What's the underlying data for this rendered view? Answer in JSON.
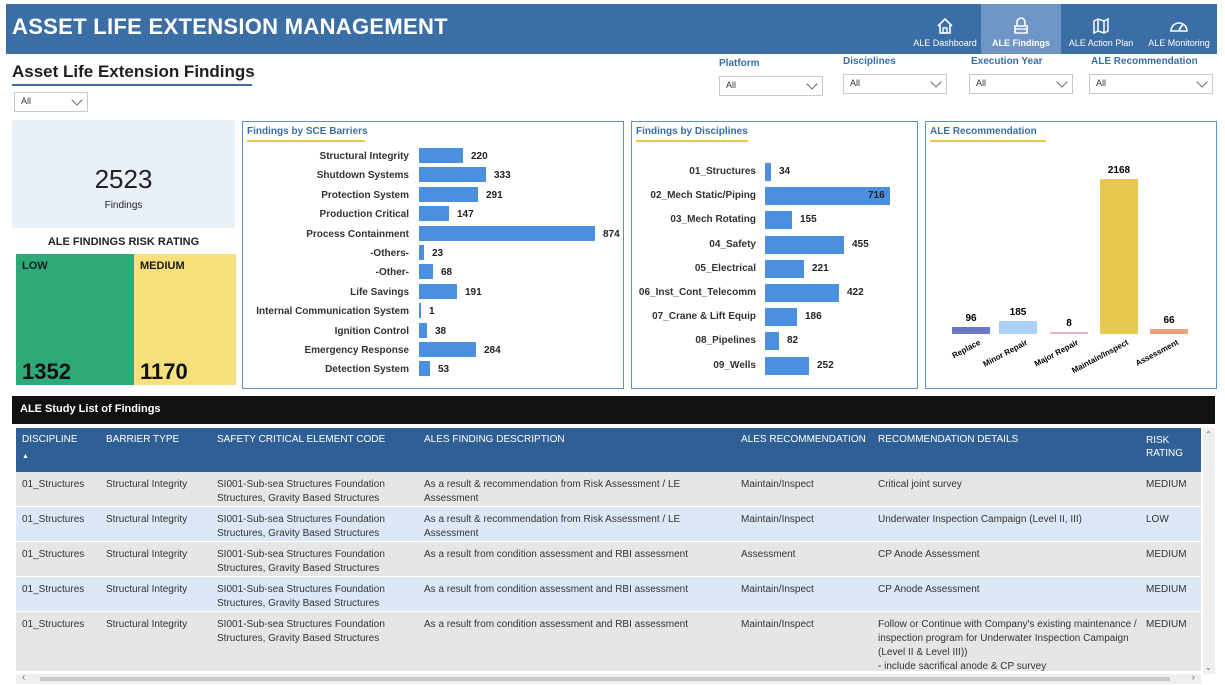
{
  "header": {
    "title": "ASSET LIFE EXTENSION MANAGEMENT",
    "nav": [
      {
        "label": "ALE Dashboard",
        "icon": "home-icon",
        "active": false
      },
      {
        "label": "ALE Findings",
        "icon": "findings-icon",
        "active": true
      },
      {
        "label": "ALE Action Plan",
        "icon": "map-icon",
        "active": false
      },
      {
        "label": "ALE Monitoring",
        "icon": "gauge-icon",
        "active": false
      }
    ]
  },
  "page": {
    "title": "Asset Life Extension Findings",
    "left_filter_value": "All"
  },
  "filters": [
    {
      "label": "Platform",
      "value": "All"
    },
    {
      "label": "Disciplines",
      "value": "All"
    },
    {
      "label": "Execution Year",
      "value": "All"
    },
    {
      "label": "ALE Recommendation",
      "value": "All"
    }
  ],
  "kpi": {
    "value": "2523",
    "label": "Findings"
  },
  "risk": {
    "title": "ALE FINDINGS RISK RATING",
    "low_label": "LOW",
    "low_value": "1352",
    "medium_label": "MEDIUM",
    "medium_value": "1170",
    "colors": {
      "low": "#2eaa79",
      "medium": "#f5e07b"
    }
  },
  "charts": {
    "sce": {
      "title": "Findings by SCE Barriers",
      "chart_data": {
        "type": "bar",
        "orientation": "horizontal",
        "categories": [
          "Structural Integrity",
          "Shutdown Systems",
          "Protection System",
          "Production Critical",
          "Process Containment",
          "-Others-",
          "-Other-",
          "Life Savings",
          "Internal Communication System",
          "Ignition Control",
          "Emergency Response",
          "Detection System"
        ],
        "values": [
          220,
          333,
          291,
          147,
          874,
          23,
          68,
          191,
          1,
          38,
          284,
          53
        ]
      }
    },
    "disc": {
      "title": "Findings by Disciplines",
      "chart_data": {
        "type": "bar",
        "orientation": "horizontal",
        "categories": [
          "01_Structures",
          "02_Mech Static/Piping",
          "03_Mech Rotating",
          "04_Safety",
          "05_Electrical",
          "06_Inst_Cont_Telecomm",
          "07_Crane & Lift Equip",
          "08_Pipelines",
          "09_Wells"
        ],
        "values": [
          34,
          716,
          155,
          455,
          221,
          422,
          186,
          82,
          252
        ]
      }
    },
    "rec": {
      "title": "ALE Recommendation",
      "chart_data": {
        "type": "bar",
        "orientation": "vertical",
        "categories": [
          "Replace",
          "Minor Repair",
          "Major Repair",
          "Maintain/Inspect",
          "Assessment"
        ],
        "values": [
          96,
          185,
          8,
          2168,
          66
        ],
        "colors": [
          "#6b78c8",
          "#a9d2f5",
          "#e8b0c4",
          "#e8c94f",
          "#ee9f7c"
        ]
      }
    },
    "bar_color": "#4a8fe0"
  },
  "table": {
    "title": "ALE Study List of Findings",
    "columns": [
      "DISCIPLINE",
      "BARRIER TYPE",
      "SAFETY CRITICAL ELEMENT CODE",
      "ALES FINDING DESCRIPTION",
      "ALES RECOMMENDATION",
      "RECOMMENDATION DETAILS",
      "RISK RATING"
    ],
    "rows": [
      [
        "01_Structures",
        "Structural Integrity",
        "SI001-Sub-sea Structures Foundation Structures, Gravity Based Structures",
        "As a result & recommendation from Risk Assessment / LE Assessment",
        "Maintain/Inspect",
        "Critical joint survey",
        "MEDIUM"
      ],
      [
        "01_Structures",
        "Structural Integrity",
        "SI001-Sub-sea Structures Foundation Structures, Gravity Based Structures",
        "As a result & recommendation from Risk Assessment / LE Assessment",
        "Maintain/Inspect",
        "Underwater Inspection Campaign (Level II, III)",
        "LOW"
      ],
      [
        "01_Structures",
        "Structural Integrity",
        "SI001-Sub-sea Structures Foundation Structures, Gravity Based Structures",
        "As a result from condition assessment and RBI assessment",
        "Assessment",
        "CP Anode Assessment",
        "MEDIUM"
      ],
      [
        "01_Structures",
        "Structural Integrity",
        "SI001-Sub-sea Structures Foundation Structures, Gravity Based Structures",
        "As a result from condition assessment and RBI assessment",
        "Maintain/Inspect",
        "CP Anode Assessment",
        "MEDIUM"
      ],
      [
        "01_Structures",
        "Structural Integrity",
        "SI001-Sub-sea Structures Foundation Structures, Gravity Based Structures",
        "As a result from condition assessment and RBI assessment",
        "Maintain/Inspect",
        "Follow or Continue with Company's existing maintenance / inspection program for Underwater Inspection Campaign (Level II & Level III))\n- include sacrifical anode & CP survey",
        "MEDIUM"
      ]
    ]
  }
}
